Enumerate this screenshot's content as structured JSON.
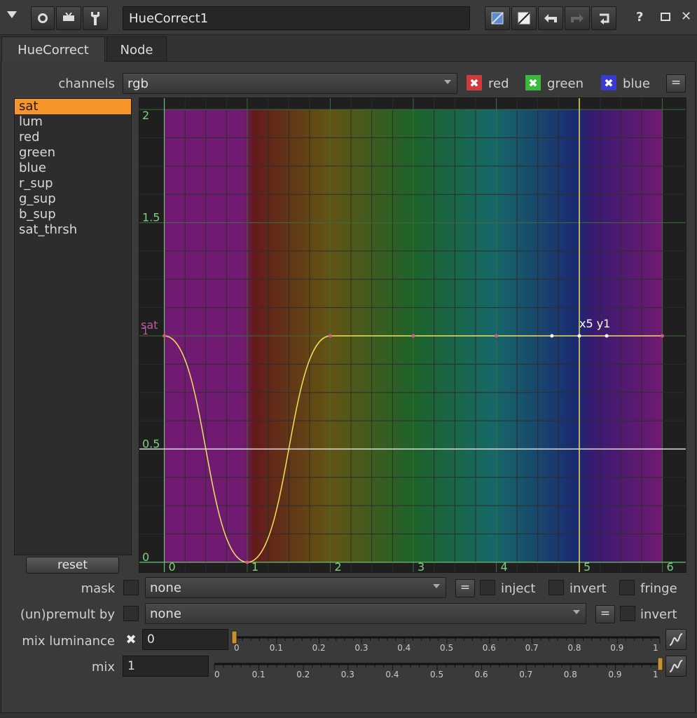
{
  "toolbar": {
    "node_name": "HueCorrect1",
    "help_label": "?"
  },
  "tabs": [
    {
      "label": "HueCorrect"
    },
    {
      "label": "Node"
    }
  ],
  "channels": {
    "label": "channels",
    "value": "rgb",
    "red_label": "red",
    "green_label": "green",
    "blue_label": "blue",
    "link_label": "="
  },
  "curves": {
    "items": [
      "sat",
      "lum",
      "red",
      "green",
      "blue",
      "r_sup",
      "g_sup",
      "b_sup",
      "sat_thrsh"
    ],
    "selected": "sat",
    "reset_label": "reset"
  },
  "graph": {
    "x_ticks": [
      "0",
      "1",
      "2",
      "3",
      "4",
      "5",
      "6"
    ],
    "y_ticks": [
      "2",
      "1.5",
      "0.5",
      "0"
    ],
    "curve_label": "sat",
    "curve_tick": "1",
    "cursor_readout": "x5 y1",
    "x_range": [
      -0.3,
      6.3
    ],
    "y_range": [
      -0.05,
      2.05
    ],
    "curve_points": [
      [
        0,
        1
      ],
      [
        1,
        0
      ],
      [
        2,
        1
      ],
      [
        3,
        1
      ],
      [
        4,
        1
      ],
      [
        4.67,
        1
      ],
      [
        5,
        1
      ],
      [
        5.33,
        1
      ],
      [
        6,
        1
      ]
    ],
    "reference_line_y": 0.5,
    "cursor_x": 5
  },
  "mask": {
    "label": "mask",
    "value": "none",
    "link_label": "=",
    "inject_label": "inject",
    "invert_label": "invert",
    "fringe_label": "fringe"
  },
  "premult": {
    "label": "(un)premult by",
    "value": "none",
    "link_label": "=",
    "invert_label": "invert"
  },
  "mix_luminance": {
    "label": "mix luminance",
    "value": "0",
    "slider_ticks": [
      "0",
      "0.1",
      "0.2",
      "0.3",
      "0.4",
      "0.5",
      "0.6",
      "0.7",
      "0.8",
      "0.9",
      "1"
    ]
  },
  "mix": {
    "label": "mix",
    "value": "1",
    "slider_ticks": [
      "0",
      "0.1",
      "0.2",
      "0.3",
      "0.4",
      "0.5",
      "0.6",
      "0.7",
      "0.8",
      "0.9",
      "1"
    ]
  },
  "colors": {
    "selection": "#f7952a",
    "curve": "#f0e060",
    "red_check": "#d23a3a",
    "green_check": "#3cb83c",
    "blue_check": "#3a3ad2"
  }
}
